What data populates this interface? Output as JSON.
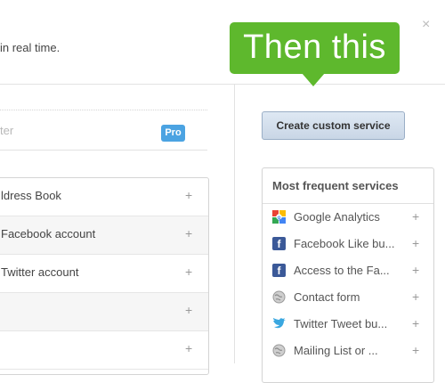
{
  "header": {
    "subtitle": "in real time.",
    "close_label": "×"
  },
  "left": {
    "filter_placeholder": "ter",
    "services": [
      {
        "label": "ldress Book",
        "pro": false
      },
      {
        "label": "Facebook account",
        "pro": false
      },
      {
        "label": "Twitter account",
        "pro": false
      },
      {
        "label": "",
        "pro": true
      },
      {
        "label": "",
        "pro": false
      }
    ],
    "pro_badge": "Pro",
    "plus": "+"
  },
  "callout": {
    "text": "Then this",
    "color": "#5eb82d"
  },
  "create_button": {
    "label": "Create custom service"
  },
  "frequent": {
    "title": "Most frequent services",
    "items": [
      {
        "icon": "google-analytics-icon",
        "label": "Google Analytics"
      },
      {
        "icon": "facebook-icon",
        "label": "Facebook Like bu..."
      },
      {
        "icon": "facebook-icon",
        "label": "Access to the Fa..."
      },
      {
        "icon": "globe-icon",
        "label": "Contact form"
      },
      {
        "icon": "twitter-bird-icon",
        "label": "Twitter Tweet bu..."
      },
      {
        "icon": "globe-icon",
        "label": "Mailing List or ..."
      }
    ],
    "plus": "+"
  }
}
